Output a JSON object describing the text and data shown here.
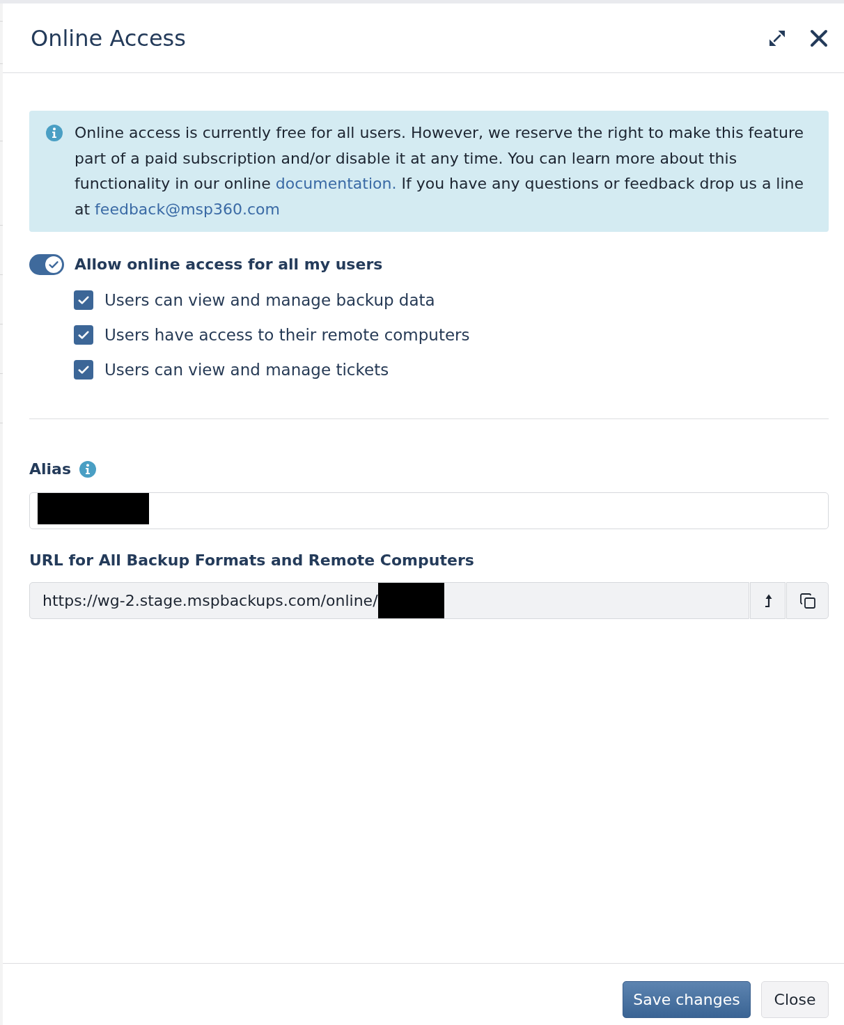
{
  "dialog": {
    "title": "Online Access"
  },
  "notice": {
    "text": "Online access is currently free for all users. However, we reserve the right to make this feature part of a paid subscription and/or disable it at any time. You can learn more about this functionality in our online ",
    "link_text": "documentation.",
    "text_after_link": " If you have any questions or feedback drop us a line at ",
    "email": "feedback@msp360.com"
  },
  "access_toggle": {
    "label": "Allow online access for all my users",
    "on": true
  },
  "permissions": [
    {
      "label": "Users can view and manage backup data",
      "checked": true
    },
    {
      "label": "Users have access to their remote computers",
      "checked": true
    },
    {
      "label": "Users can view and manage tickets",
      "checked": true
    }
  ],
  "alias": {
    "label": "Alias",
    "value_redacted": true
  },
  "url": {
    "label": "URL for All Backup Formats and Remote Computers",
    "value": "https://wg-2.stage.mspbackups.com/online/",
    "value_redacted": true
  },
  "buttons": [
    {
      "label": "Save changes",
      "kind": "primary"
    },
    {
      "label": "Close",
      "kind": "secondary"
    }
  ]
}
